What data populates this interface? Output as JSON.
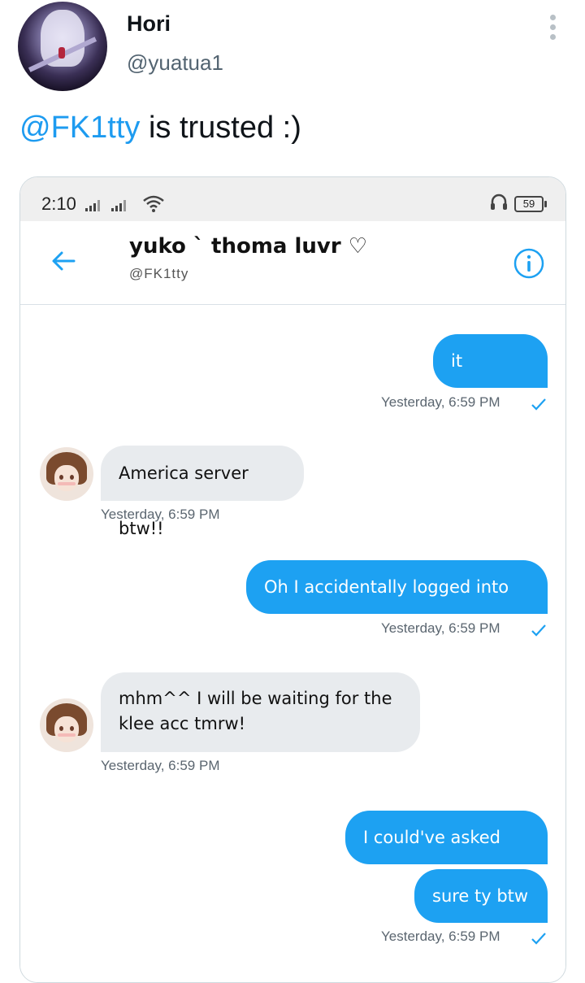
{
  "tweet": {
    "author_name": "Hori",
    "author_handle": "@yuatua1",
    "mention": "@FK1tty",
    "text": " is trusted :)"
  },
  "screenshot": {
    "status_bar": {
      "time": "2:10",
      "battery": "59"
    },
    "header": {
      "name": "yuko ` thoma luvr ♡",
      "handle": "@FK1tty"
    },
    "messages": [
      {
        "direction": "out",
        "text": "it worked",
        "timestamp": "Yesterday, 6:59 PM"
      },
      {
        "direction": "in",
        "text": "America server btw!!",
        "timestamp": "Yesterday, 6:59 PM"
      },
      {
        "direction": "out",
        "text": "Oh I accidentally logged into asia",
        "timestamp": "Yesterday, 6:59 PM"
      },
      {
        "direction": "in",
        "text_lines": [
          "mhm^^ I will be waiting for the",
          "klee acc tmrw!"
        ],
        "timestamp": "Yesterday, 6:59 PM"
      },
      {
        "direction": "out",
        "text": "I could've asked first"
      },
      {
        "direction": "out",
        "text": "sure ty btw",
        "timestamp": "Yesterday, 6:59 PM"
      }
    ],
    "colors": {
      "outgoing_bubble": "#1da1f2",
      "incoming_bubble": "#e8ebee",
      "accent": "#1da1f2"
    }
  }
}
